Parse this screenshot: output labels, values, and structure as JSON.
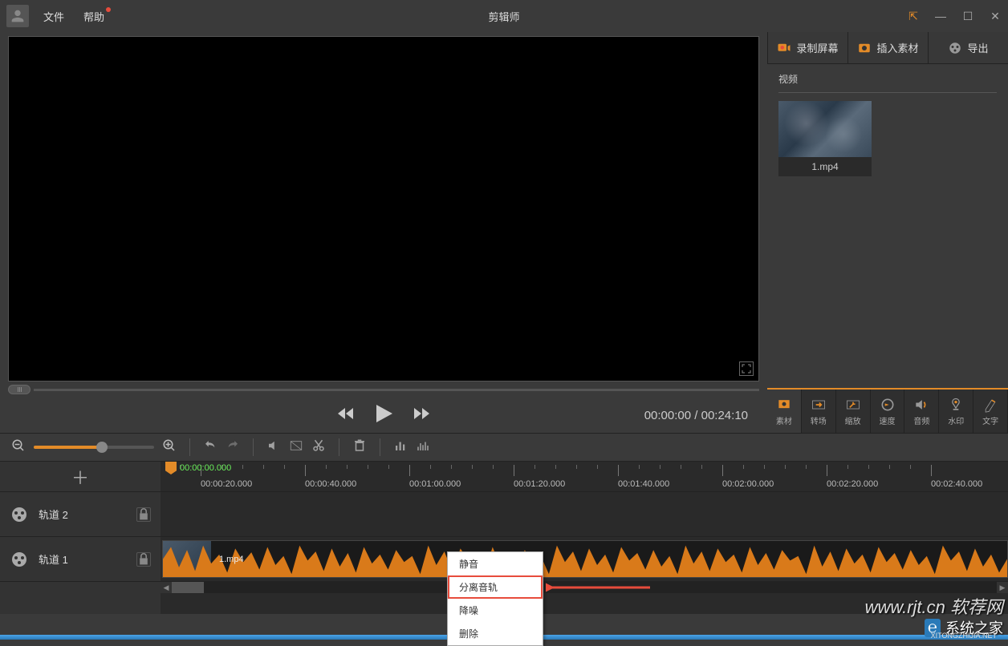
{
  "titlebar": {
    "menu_file": "文件",
    "menu_help": "帮助",
    "app_title": "剪辑师"
  },
  "playback": {
    "current_time": "00:00:00",
    "total_time": "00:24:10"
  },
  "right_panel": {
    "actions": {
      "record": "录制屏幕",
      "import": "插入素材",
      "export": "导出"
    },
    "section_video": "视频",
    "thumb_name": "1.mp4",
    "tools": {
      "material": "素材",
      "transition": "转场",
      "zoom": "缩放",
      "speed": "速度",
      "audio": "音频",
      "watermark": "水印",
      "text": "文字"
    }
  },
  "timeline": {
    "playhead_time": "00:00:00.000",
    "ruler_ticks": [
      "00:00:20.000",
      "00:00:40.000",
      "00:01:00.000",
      "00:01:20.000",
      "00:01:40.000",
      "00:02:00.000",
      "00:02:20.000",
      "00:02:40.000"
    ],
    "track2": "轨道 2",
    "track1": "轨道 1",
    "clip_name": "1.mp4"
  },
  "context_menu": {
    "mute": "静音",
    "separate_audio": "分离音轨",
    "denoise": "降噪",
    "delete": "删除"
  },
  "watermarks": {
    "wm1": "www.rjt.cn 软荐网",
    "wm2_text": "系统之家",
    "wm2_sub": "XITONGZHIJIA.NET"
  }
}
